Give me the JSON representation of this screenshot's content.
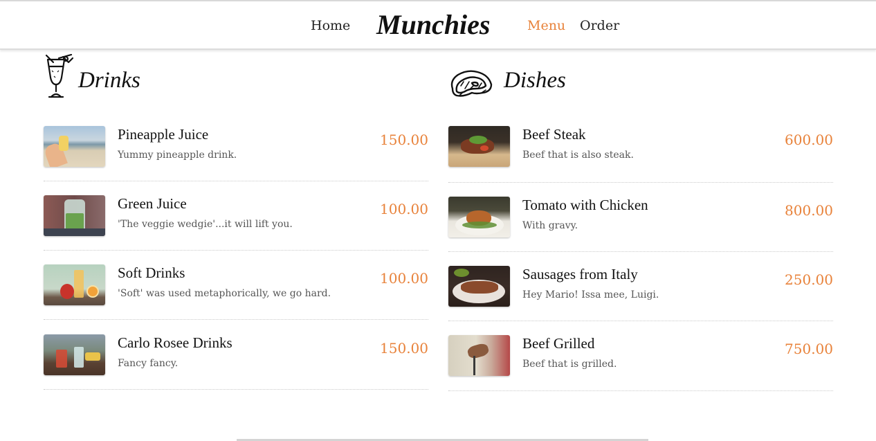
{
  "nav": {
    "home": "Home",
    "brand": "Munchies",
    "menu": "Menu",
    "order": "Order",
    "accent_color": "#e8823a"
  },
  "drinks": {
    "title": "Drinks",
    "icon": "cocktail-glass-icon",
    "items": [
      {
        "name": "Pineapple Juice",
        "desc": "Yummy pineapple drink.",
        "price": "150.00"
      },
      {
        "name": "Green Juice",
        "desc": "'The veggie wedgie'...it will lift you.",
        "price": "100.00"
      },
      {
        "name": "Soft Drinks",
        "desc": "'Soft' was used metaphorically, we go hard.",
        "price": "100.00"
      },
      {
        "name": "Carlo Rosee Drinks",
        "desc": "Fancy fancy.",
        "price": "150.00"
      }
    ]
  },
  "dishes": {
    "title": "Dishes",
    "icon": "steak-icon",
    "items": [
      {
        "name": "Beef Steak",
        "desc": "Beef that is also steak.",
        "price": "600.00"
      },
      {
        "name": "Tomato with Chicken",
        "desc": "With gravy.",
        "price": "800.00"
      },
      {
        "name": "Sausages from Italy",
        "desc": "Hey Mario! Issa mee, Luigi.",
        "price": "250.00"
      },
      {
        "name": "Beef Grilled",
        "desc": "Beef that is grilled.",
        "price": "750.00"
      }
    ]
  }
}
